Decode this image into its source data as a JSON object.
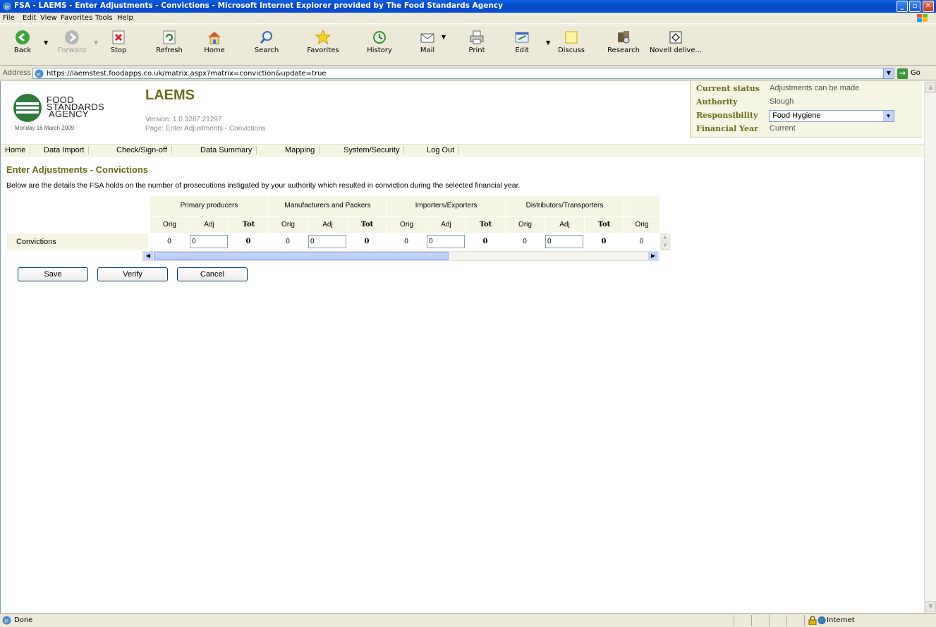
{
  "window": {
    "title": "FSA - LAEMS - Enter Adjustments - Convictions - Microsoft Internet Explorer provided by The Food Standards Agency"
  },
  "menu": [
    "File",
    "Edit",
    "View",
    "Favorites",
    "Tools",
    "Help"
  ],
  "toolbar": {
    "back": "Back",
    "forward": "Forward",
    "stop": "Stop",
    "refresh": "Refresh",
    "home": "Home",
    "search": "Search",
    "favorites": "Favorites",
    "history": "History",
    "mail": "Mail",
    "print": "Print",
    "edit": "Edit",
    "discuss": "Discuss",
    "research": "Research",
    "novell": "Novell delive..."
  },
  "address": {
    "label": "Address",
    "url": "https://laemstest.foodapps.co.uk/matrix.aspx?matrix=conviction&update=true",
    "go": "Go"
  },
  "header": {
    "logo_lines": [
      "FOOD",
      "STANDARDS",
      "AGENCY"
    ],
    "date": "Monday 16 March 2009",
    "app_title": "LAEMS",
    "version": "Version: 1.0.3287.21297",
    "page": "Page: Enter Adjustments - Convictions"
  },
  "status": {
    "current_status_label": "Current status",
    "current_status_value": "Adjustments can be made",
    "authority_label": "Authority",
    "authority_value": "Slough",
    "responsibility_label": "Responsibility",
    "responsibility_value": "Food Hygiene",
    "financial_year_label": "Financial Year",
    "financial_year_value": "Current"
  },
  "nav": [
    "Home",
    "Data Import",
    "Check/Sign-off",
    "Data Summary",
    "Mapping",
    "System/Security",
    "Log Out"
  ],
  "main": {
    "title": "Enter Adjustments - Convictions",
    "description": "Below are the details the FSA holds on the number of prosecutions instigated by your authority which resulted in conviction during the selected financial year."
  },
  "grid": {
    "groups": [
      "Primary producers",
      "Manufacturers and Packers",
      "Importers/Exporters",
      "Distributors/Transporters"
    ],
    "sub_headers": [
      "Orig",
      "Adj",
      "Tot"
    ],
    "trailing_sub": "Orig",
    "row_label": "Convictions",
    "values": [
      {
        "orig": "0",
        "adj": "0",
        "tot": "0"
      },
      {
        "orig": "0",
        "adj": "0",
        "tot": "0"
      },
      {
        "orig": "0",
        "adj": "0",
        "tot": "0"
      },
      {
        "orig": "0",
        "adj": "0",
        "tot": "0"
      }
    ],
    "trailing_value": "0"
  },
  "buttons": {
    "save": "Save",
    "verify": "Verify",
    "cancel": "Cancel"
  },
  "statusbar": {
    "text": "Done",
    "zone": "Internet"
  }
}
